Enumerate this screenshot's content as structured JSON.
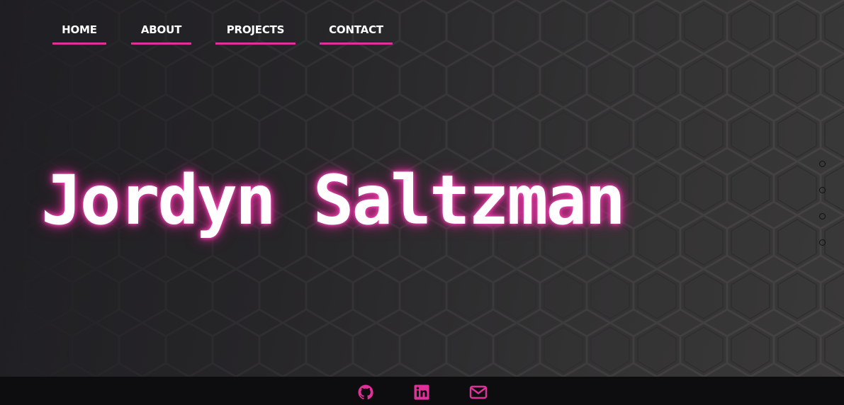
{
  "nav": {
    "items": [
      {
        "label": "HOME"
      },
      {
        "label": "ABOUT"
      },
      {
        "label": "PROJECTS"
      },
      {
        "label": "CONTACT"
      }
    ]
  },
  "hero": {
    "title": "Jordyn Saltzman"
  },
  "page_dots": {
    "count": 4
  },
  "footer": {
    "links": [
      {
        "icon": "github-icon"
      },
      {
        "icon": "linkedin-icon"
      },
      {
        "icon": "email-icon"
      }
    ]
  },
  "colors": {
    "accent": "#e0309a",
    "background": "#1e1d21",
    "footer": "#0d0c0e",
    "text": "#ffffff"
  }
}
